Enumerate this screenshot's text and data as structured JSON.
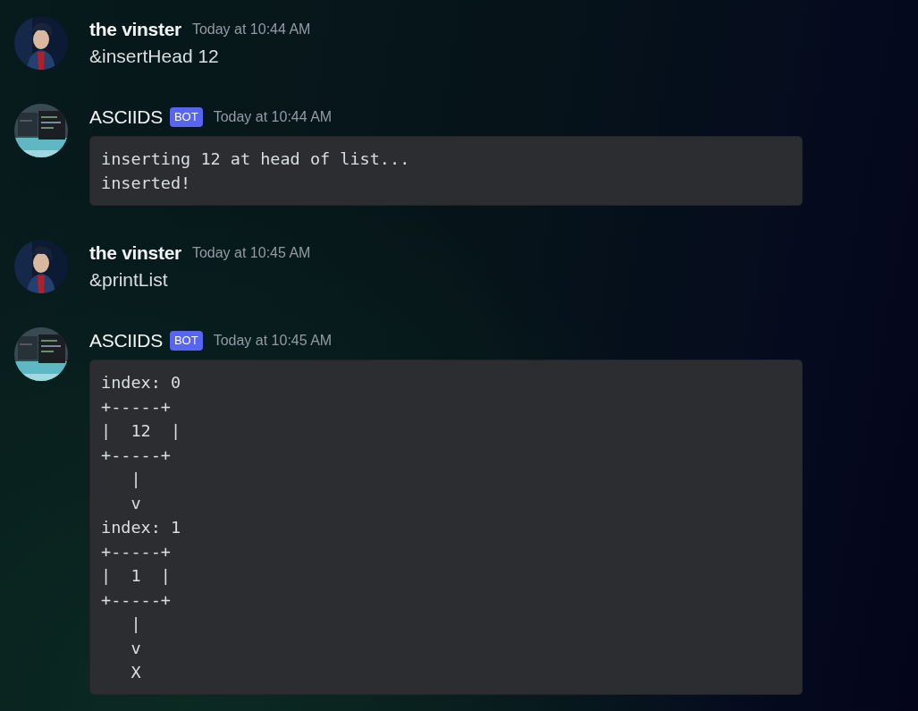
{
  "messages": [
    {
      "author": "the vinster",
      "timestamp": "Today at 10:44 AM",
      "text": "&insertHead 12"
    },
    {
      "author": "ASCIIDS",
      "badge": "BOT",
      "timestamp": "Today at 10:44 AM",
      "code": "inserting 12 at head of list...\ninserted!"
    },
    {
      "author": "the vinster",
      "timestamp": "Today at 10:45 AM",
      "text": "&printList"
    },
    {
      "author": "ASCIIDS",
      "badge": "BOT",
      "timestamp": "Today at 10:45 AM",
      "code": "index: 0\n+-----+\n|  12  |\n+-----+\n   |\n   v\nindex: 1\n+-----+\n|  1  |\n+-----+\n   |\n   v\n   X"
    }
  ]
}
